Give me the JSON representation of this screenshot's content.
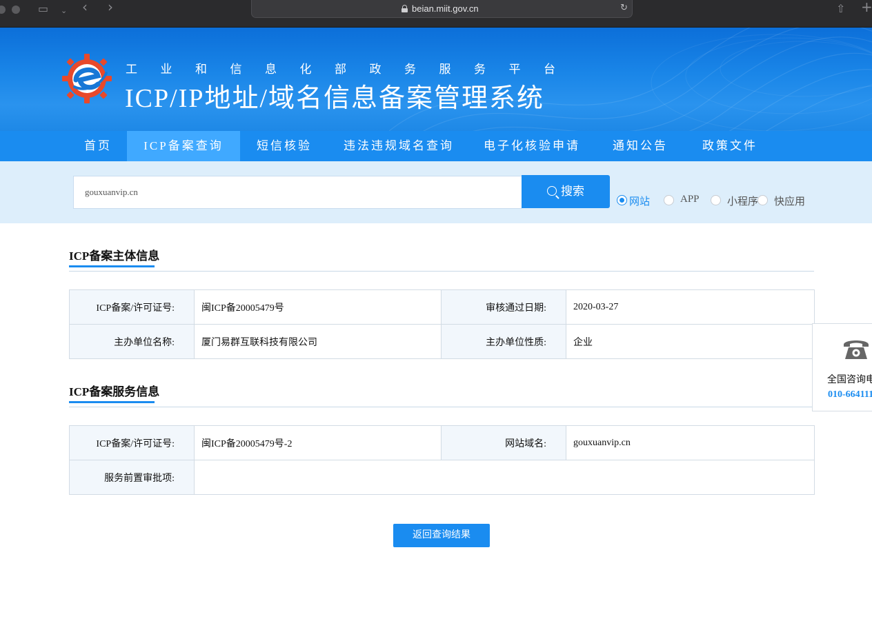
{
  "browser": {
    "url": "beian.miit.gov.cn"
  },
  "header": {
    "subtitle": "工业和信息化部政务服务平台",
    "title": "ICP/IP地址/域名信息备案管理系统"
  },
  "nav": {
    "items": [
      "首页",
      "ICP备案查询",
      "短信核验",
      "违法违规域名查询",
      "电子化核验申请",
      "通知公告",
      "政策文件"
    ],
    "active_index": 1
  },
  "search": {
    "value": "gouxuanvip.cn",
    "button_label": "搜索",
    "options": [
      "网站",
      "APP",
      "小程序",
      "快应用"
    ],
    "selected": "网站"
  },
  "subject_section": {
    "title": "ICP备案主体信息",
    "rows": [
      [
        {
          "label": "ICP备案/许可证号:",
          "value": "闽ICP备20005479号"
        },
        {
          "label": "审核通过日期:",
          "value": "2020-03-27"
        }
      ],
      [
        {
          "label": "主办单位名称:",
          "value": "厦门易群互联科技有限公司"
        },
        {
          "label": "主办单位性质:",
          "value": "企业"
        }
      ]
    ]
  },
  "service_section": {
    "title": "ICP备案服务信息",
    "licence_label": "ICP备案/许可证号:",
    "licence_value": "闽ICP备20005479号-2",
    "domain_label": "网站域名:",
    "domain_value": "gouxuanvip.cn",
    "approval_label": "服务前置审批项:",
    "approval_value": ""
  },
  "back_button": "返回查询结果",
  "contact": {
    "label": "全国咨询电",
    "number": "010-664111"
  },
  "colors": {
    "primary": "#1a8cf0",
    "nav_active": "#40a9ff",
    "search_bg": "#ddeefb",
    "table_key_bg": "#f2f7fc"
  }
}
